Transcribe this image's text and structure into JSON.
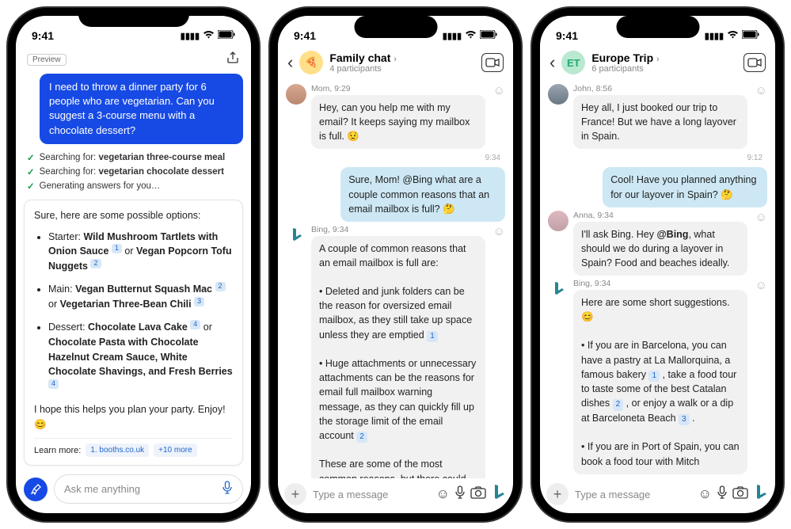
{
  "status": {
    "time": "9:41"
  },
  "phone1": {
    "preview": "Preview",
    "user_msg": "I need to throw a dinner party for 6 people who are vegetarian. Can you suggest a 3-course menu with a chocolate dessert?",
    "search1_prefix": "Searching for:",
    "search1_term": "vegetarian three-course meal",
    "search2_prefix": "Searching for:",
    "search2_term": "vegetarian chocolate dessert",
    "search3": "Generating answers for you…",
    "intro": "Sure, here are some possible options:",
    "starter_label": "Starter:",
    "starter1": "Wild Mushroom Tartlets with Onion Sauce",
    "or": "or",
    "starter2": "Vegan Popcorn Tofu Nuggets",
    "main_label": "Main:",
    "main1": "Vegan Butternut Squash Mac",
    "main2": "Vegetarian Three-Bean Chili",
    "dessert_label": "Dessert:",
    "dessert1": "Chocolate Lava Cake",
    "dessert2": "Chocolate Pasta with Chocolate Hazelnut Cream Sauce, White Chocolate Shavings, and Fresh Berries",
    "outro": "I hope this helps you plan your party. Enjoy! 😊",
    "learn_more": "Learn more:",
    "lm1": "1. booths.co.uk",
    "lm2": "+10 more",
    "placeholder": "Ask me anything"
  },
  "phone2": {
    "title": "Family chat",
    "sub": "4 participants",
    "m1_meta": "Mom, 9:29",
    "m1_text": "Hey, can you help me with my email? It keeps saying my mailbox is full. 😟",
    "t1": "9:34",
    "m2_text": "Sure, Mom! @Bing what are a couple common reasons that an email mailbox is full? 🤔",
    "m3_meta": "Bing, 9:34",
    "m3_p1": "A couple of common reasons that an email mailbox is full are:",
    "m3_b1": "• Deleted and junk folders can be the reason for oversized email mailbox, as they still take up space unless they are emptied",
    "m3_b2": "• Huge attachments or unnecessary attachments can be the reasons for email full mailbox warning message, as they can quickly fill up the storage limit of the email account",
    "m3_p2": "These are some of the most common reasons, but there could be other factors as well",
    "placeholder": "Type a message"
  },
  "phone3": {
    "title": "Europe Trip",
    "sub": "6 participants",
    "avatar_text": "ET",
    "m1_meta": "John, 8:56",
    "m1_text": "Hey all, I just booked our trip to France! But we have a long layover in Spain.",
    "t1": "9:12",
    "m2_text": "Cool! Have you planned anything for our layover in Spain? 🤔",
    "m3_meta": "Anna, 9:34",
    "m3_text_a": "I'll ask Bing. Hey ",
    "m3_text_mention": "@Bing",
    "m3_text_b": ", what should we do during a layover in Spain? Food and beaches ideally.",
    "m4_meta": "Bing, 9:34",
    "m4_p1": "Here are some short suggestions. 😊",
    "m4_b1a": "• If you are in Barcelona, you can have a pastry at La Mallorquina, a famous bakery",
    "m4_b1b": ", take a food tour to taste some of the best Catalan dishes",
    "m4_b1c": ", or enjoy a walk or a dip at Barceloneta Beach",
    "m4_b2": "• If you are in Port of Spain, you can book a food tour with Mitch",
    "placeholder": "Type a message"
  }
}
